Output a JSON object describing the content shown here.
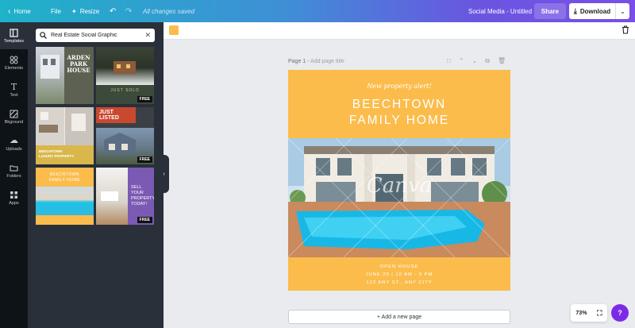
{
  "topbar": {
    "home": "Home",
    "file": "File",
    "resize": "Resize",
    "status": "All changes saved",
    "doc_title": "Social Media - Untitled",
    "share": "Share",
    "download": "Download"
  },
  "rail": [
    {
      "label": "Templates",
      "icon": "template-icon"
    },
    {
      "label": "Elements",
      "icon": "elements-icon"
    },
    {
      "label": "Text",
      "icon": "text-icon"
    },
    {
      "label": "Bkground",
      "icon": "background-icon"
    },
    {
      "label": "Uploads",
      "icon": "upload-icon"
    },
    {
      "label": "Folders",
      "icon": "folder-icon"
    },
    {
      "label": "Apps",
      "icon": "apps-icon"
    }
  ],
  "search": {
    "value": "Real Estate Social Graphic"
  },
  "templates": [
    {
      "id": "t1",
      "lines": [
        "ARDEN",
        "PARK",
        "HOUSE"
      ]
    },
    {
      "id": "t2",
      "lines": [
        "JUST SOLD"
      ],
      "badge": "FREE"
    },
    {
      "id": "t3",
      "lines": [
        "BEECHTOWN",
        "LUXURY PROPERTY"
      ]
    },
    {
      "id": "t4",
      "lines": [
        "JUST LISTED"
      ],
      "badge": "FREE"
    },
    {
      "id": "t5",
      "lines": [
        "BEECHTOWN",
        "FAMILY HOME"
      ]
    },
    {
      "id": "t6",
      "lines": [
        "SELL",
        "YOUR",
        "PROPERTY",
        "TODAY!"
      ],
      "badge": "FREE"
    }
  ],
  "canvas": {
    "swatch_color": "#fbbc4c",
    "page_label": "Page 1 -",
    "page_title_hint": "Add page title",
    "alert": "New property alert!",
    "title_line1": "BEECHTOWN",
    "title_line2": "FAMILY HOME",
    "watermark": "Canva",
    "info_line1": "OPEN HOUSE",
    "info_line2": "JUNE 20 | 10 AM - 5 PM",
    "info_line3": "123 ANY ST., ANY CITY",
    "add_page": "+ Add a new page",
    "zoom": "73%",
    "help": "?"
  },
  "colors": {
    "accent": "#fbbc4c",
    "panel": "#293039",
    "rail": "#0e1318",
    "help": "#7d2ae8"
  }
}
